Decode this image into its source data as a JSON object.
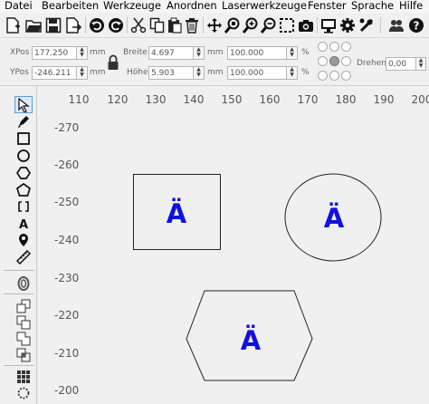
{
  "menu": [
    {
      "id": "datei",
      "label": "Datei"
    },
    {
      "id": "bearbeiten",
      "label": "Bearbeiten"
    },
    {
      "id": "werkzeuge",
      "label": "Werkzeuge"
    },
    {
      "id": "anordnen",
      "label": "Anordnen"
    },
    {
      "id": "laserwerkzeuge",
      "label": "Laserwerkzeuge"
    },
    {
      "id": "fenster",
      "label": "Fenster"
    },
    {
      "id": "sprache",
      "label": "Sprache"
    },
    {
      "id": "hilfe",
      "label": "Hilfe"
    }
  ],
  "props": {
    "xpos_label": "XPos",
    "xpos_value": "177.250",
    "xpos_unit": "mm",
    "ypos_label": "YPos",
    "ypos_value": "-246.211",
    "ypos_unit": "mm",
    "width_label": "Breite",
    "width_value": "4.697",
    "width_unit": "mm",
    "height_label": "Höhe",
    "height_value": "5.903",
    "height_unit": "mm",
    "scale_x_value": "100.000",
    "scale_x_unit": "%",
    "scale_y_value": "100.000",
    "scale_y_unit": "%",
    "rotate_label": "Drehen",
    "rotate_value": "0,00"
  },
  "ruler": {
    "h_ticks": [
      "110",
      "120",
      "130",
      "140",
      "150",
      "160",
      "170",
      "180",
      "190",
      "200"
    ],
    "v_ticks": [
      "-270",
      "-260",
      "-250",
      "-240",
      "-230",
      "-220",
      "-210",
      "-200"
    ]
  },
  "shapes": {
    "glyph": "Ä",
    "glyph_color": "#1010e0"
  }
}
